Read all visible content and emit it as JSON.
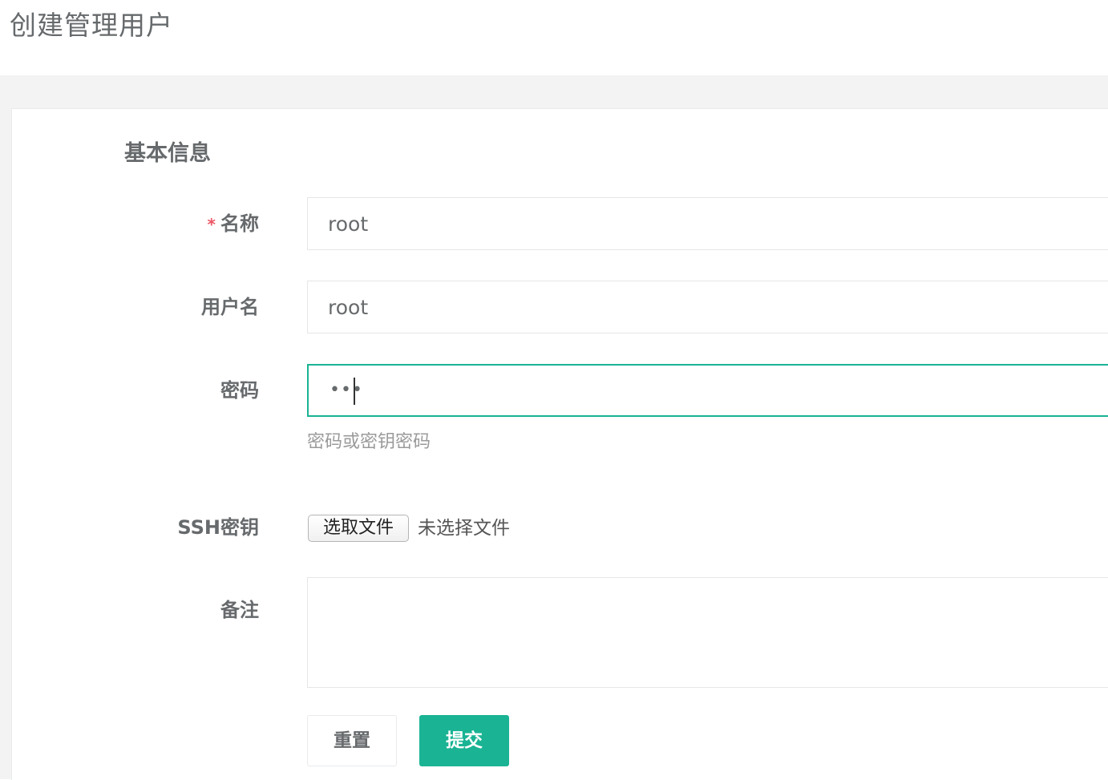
{
  "header": {
    "title": "创建管理用户"
  },
  "form": {
    "section_title": "基本信息",
    "required_mark": "*",
    "name": {
      "label": "名称",
      "value": "root"
    },
    "username": {
      "label": "用户名",
      "value": "root"
    },
    "password": {
      "label": "密码",
      "masked_value": "•••",
      "help": "密码或密钥密码"
    },
    "ssh_key": {
      "label": "SSH密钥",
      "button_label": "选取文件",
      "status": "未选择文件"
    },
    "comment": {
      "label": "备注",
      "value": ""
    },
    "buttons": {
      "reset": "重置",
      "submit": "提交"
    }
  },
  "colors": {
    "accent": "#1ab394",
    "required": "#ed5565",
    "text": "#676a6c",
    "muted": "#9a9a9a",
    "background": "#f3f3f4"
  }
}
